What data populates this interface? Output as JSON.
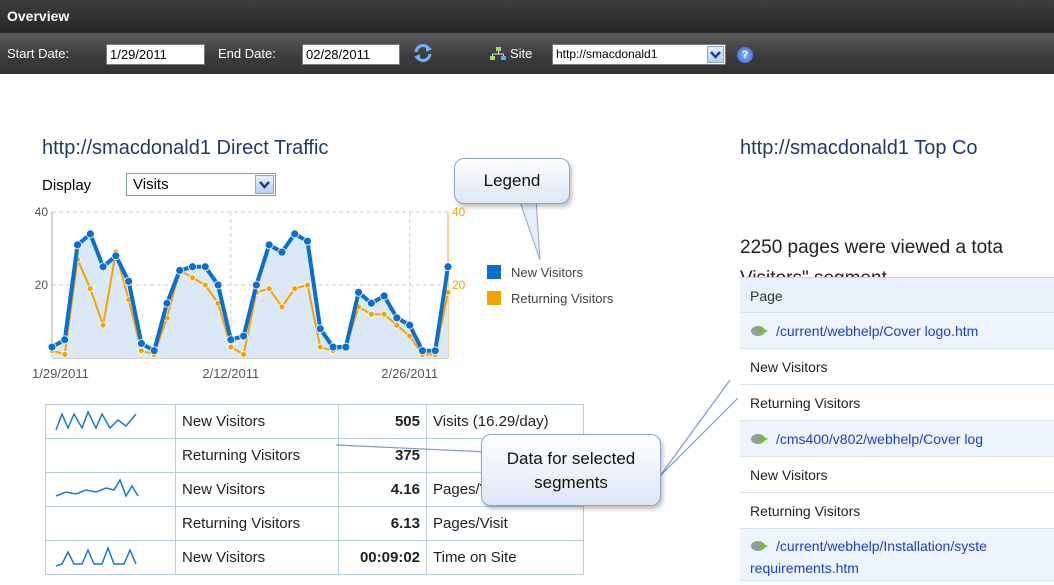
{
  "header": {
    "title": "Overview"
  },
  "toolbar": {
    "start_label": "Start Date:",
    "start_value": "1/29/2011",
    "end_label": "End Date:",
    "end_value": "02/28/2011",
    "site_label": "Site",
    "site_value": "http://smacdonald1",
    "help": "?"
  },
  "left": {
    "title": "http://smacdonald1 Direct Traffic",
    "display_label": "Display",
    "display_value": "Visits"
  },
  "chart_data": {
    "type": "line",
    "x_labels": [
      "1/29/2011",
      "2/12/2011",
      "2/26/2011"
    ],
    "y_ticks_left": [
      "40",
      "20"
    ],
    "y_ticks_right": [
      "40",
      "20"
    ],
    "ylim": [
      0,
      40
    ],
    "series": [
      {
        "name": "New Visitors",
        "color": "#0b6fcf",
        "values": [
          3,
          5,
          31,
          34,
          25,
          28,
          21,
          4,
          2,
          15,
          24,
          25,
          25,
          20,
          5,
          6,
          20,
          31,
          29,
          34,
          32,
          8,
          3,
          3,
          18,
          15,
          17,
          11,
          9,
          2,
          2,
          25
        ]
      },
      {
        "name": "Returning Visitors",
        "color": "#f5a300",
        "values": [
          2,
          1,
          27,
          19,
          9,
          29,
          16,
          2,
          1,
          11,
          24,
          22,
          20,
          15,
          3,
          1,
          18,
          19,
          14,
          19,
          20,
          3,
          2,
          3,
          14,
          12,
          12,
          9,
          6,
          1,
          1,
          18
        ]
      }
    ]
  },
  "callouts": {
    "legend": "Legend",
    "data": [
      "Data for selected",
      "segments"
    ]
  },
  "stats": [
    {
      "has_spark": true,
      "label": "New Visitors",
      "value": "505",
      "metric": "Visits (16.29/day)"
    },
    {
      "has_spark": false,
      "label": "Returning Visitors",
      "value": "375",
      "metric": ""
    },
    {
      "has_spark": true,
      "label": "New Visitors",
      "value": "4.16",
      "metric": "Pages/Visit"
    },
    {
      "has_spark": false,
      "label": "Returning Visitors",
      "value": "6.13",
      "metric": "Pages/Visit"
    },
    {
      "has_spark": true,
      "label": "New Visitors",
      "value": "00:09:02",
      "metric": "Time on Site"
    }
  ],
  "right": {
    "title": "http://smacdonald1 Top Co",
    "desc_line1": "2250 pages were viewed a tota",
    "desc_line2": "Visitors\" segment",
    "table_header": "Page",
    "rows": [
      {
        "type": "link",
        "text": "/current/webhelp/Cover logo.htm"
      },
      {
        "type": "text",
        "text": "New Visitors"
      },
      {
        "type": "text",
        "text": "Returning Visitors"
      },
      {
        "type": "link",
        "text": "/cms400/v802/webhelp/Cover log"
      },
      {
        "type": "text",
        "text": "New Visitors"
      },
      {
        "type": "text",
        "text": "Returning Visitors"
      },
      {
        "type": "link2",
        "text": "/current/webhelp/Installation/syste",
        "text2": "requirements.htm"
      }
    ]
  }
}
